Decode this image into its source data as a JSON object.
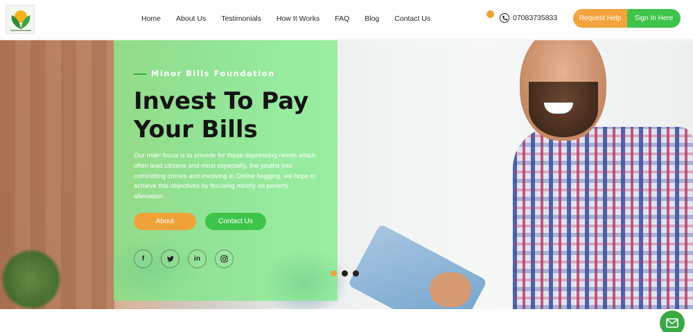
{
  "header": {
    "nav": [
      "Home",
      "About Us",
      "Testimonials",
      "How It Works",
      "FAQ",
      "Blog",
      "Contact Us"
    ],
    "phone": "07083735833",
    "request_help_label": "Request Help",
    "sign_in_label": "Sign In Here"
  },
  "hero": {
    "kicker": "Minor Bills Foundation",
    "title": "Invest To Pay Your Bills",
    "description": "Our main focus is to provide for those depressing needs which often lead citizens and most especially, the youths into committing crimes and involving in Online begging. we hope to achieve this objectives by focusing mostly on poverty alleviation.",
    "about_label": "About",
    "contact_label": "Contact Us",
    "socials": [
      {
        "name": "facebook-icon",
        "glyph": "f"
      },
      {
        "name": "twitter-icon",
        "glyph": "t"
      },
      {
        "name": "linkedin-icon",
        "glyph": "in"
      },
      {
        "name": "instagram-icon",
        "glyph": "◎"
      }
    ],
    "slide_indicator": {
      "count": 3,
      "active": 1
    }
  },
  "colors": {
    "orange": "#f0a23a",
    "green": "#3ec44a",
    "panel_green": "#78eb82"
  }
}
